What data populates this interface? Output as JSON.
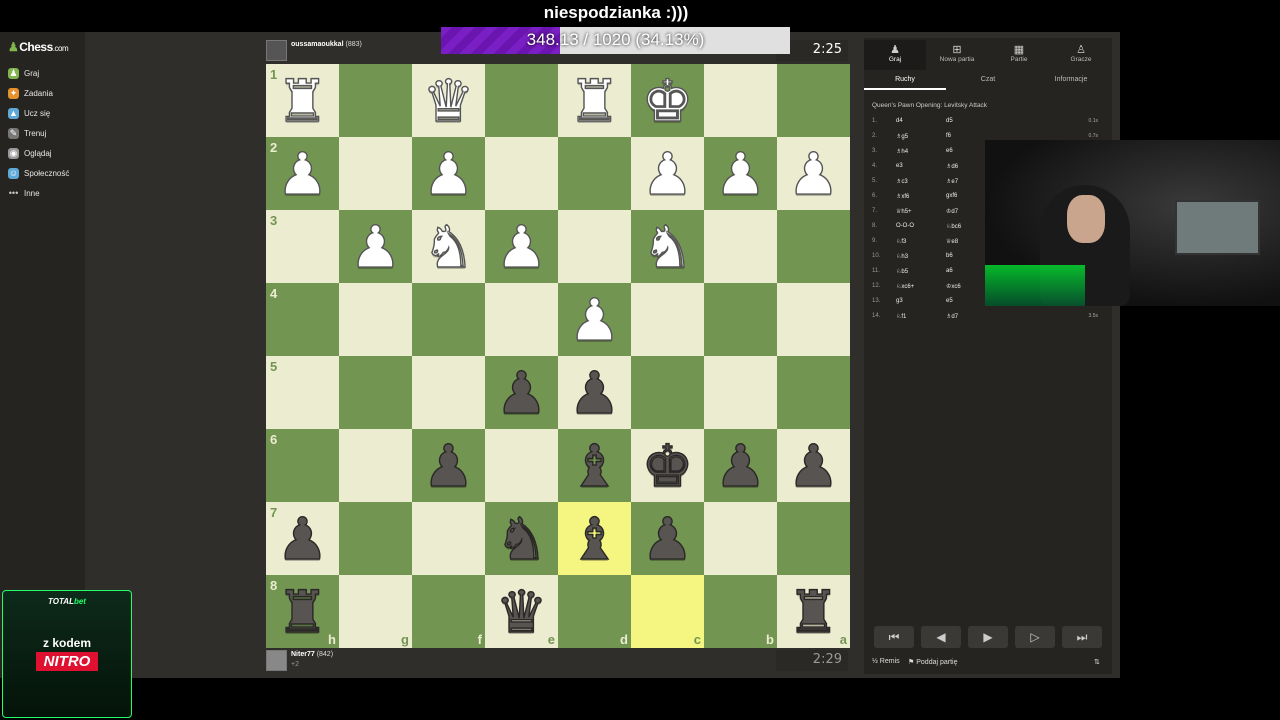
{
  "overlay": {
    "title": "niespodzianka :)))",
    "progress_text": "348.13 / 1020 (34.13%)",
    "progress_fraction": 0.3413
  },
  "sidebar": {
    "logo": "Chess",
    "logo_suffix": ".com",
    "items": [
      {
        "label": "Graj",
        "icon": "play-icon",
        "color": "#81b64c"
      },
      {
        "label": "Zadania",
        "icon": "puzzle-icon",
        "color": "#e6912c"
      },
      {
        "label": "Ucz się",
        "icon": "learn-icon",
        "color": "#5fa9d8"
      },
      {
        "label": "Trenuj",
        "icon": "train-icon",
        "color": "#777777"
      },
      {
        "label": "Oglądaj",
        "icon": "watch-icon",
        "color": "#999999"
      },
      {
        "label": "Społeczność",
        "icon": "community-icon",
        "color": "#5fa9d8"
      },
      {
        "label": "Inne",
        "icon": "more-icon",
        "color": "#999999"
      }
    ]
  },
  "top_player": {
    "name": "oussamaoukkal",
    "rating": "(883)",
    "clock": "2:25"
  },
  "bottom_player": {
    "name": "Niter77",
    "rating": "(842)",
    "sub": "+2",
    "clock": "2:29"
  },
  "board": {
    "ranks": [
      "1",
      "2",
      "3",
      "4",
      "5",
      "6",
      "7",
      "8"
    ],
    "files": [
      "h",
      "g",
      "f",
      "e",
      "d",
      "c",
      "b",
      "a"
    ],
    "rows": [
      [
        "wR",
        "",
        "wQ",
        "",
        "wR",
        "wK",
        "",
        ""
      ],
      [
        "wP",
        "",
        "wP",
        "",
        "",
        "wP",
        "wP",
        "wP"
      ],
      [
        "",
        "wP",
        "wN",
        "wP",
        "",
        "wN",
        "",
        ""
      ],
      [
        "",
        "",
        "",
        "",
        "wP",
        "",
        "",
        ""
      ],
      [
        "",
        "",
        "",
        "bP",
        "bP",
        "",
        "",
        ""
      ],
      [
        "",
        "",
        "bP",
        "",
        "bB",
        "bK",
        "bP",
        "bP"
      ],
      [
        "bP",
        "",
        "",
        "bN",
        "bB",
        "bP",
        "",
        ""
      ],
      [
        "bR",
        "",
        "",
        "bQ",
        "",
        "",
        "",
        "bR"
      ]
    ],
    "highlight": [
      "6-4",
      "7-5"
    ]
  },
  "right_panel": {
    "tabs": [
      {
        "label": "Graj",
        "icon": "play-icon"
      },
      {
        "label": "Nowa partia",
        "icon": "plus-icon"
      },
      {
        "label": "Partie",
        "icon": "board-icon"
      },
      {
        "label": "Gracze",
        "icon": "players-icon"
      }
    ],
    "subtabs": [
      "Ruchy",
      "Czat",
      "Informacje"
    ],
    "opening": "Queen's Pawn Opening: Levitsky Attack",
    "moves": [
      {
        "n": "1.",
        "w": "d4",
        "b": "d5",
        "t": "0.1s"
      },
      {
        "n": "2.",
        "w": "♗g5",
        "b": "f6",
        "t": "0.7s"
      },
      {
        "n": "3.",
        "w": "♗h4",
        "b": "e6",
        "t": ""
      },
      {
        "n": "4.",
        "w": "e3",
        "b": "♗d6",
        "t": ""
      },
      {
        "n": "5.",
        "w": "♗c3",
        "b": "♗e7",
        "t": ""
      },
      {
        "n": "6.",
        "w": "♗xf6",
        "b": "gxf6",
        "t": ""
      },
      {
        "n": "7.",
        "w": "♕h5+",
        "b": "♔d7",
        "t": ""
      },
      {
        "n": "8.",
        "w": "O-O-O",
        "b": "♘bc6",
        "t": ""
      },
      {
        "n": "9.",
        "w": "♘f3",
        "b": "♕e8",
        "t": ""
      },
      {
        "n": "10.",
        "w": "♘h3",
        "b": "b6",
        "t": ""
      },
      {
        "n": "11.",
        "w": "♘b5",
        "b": "a6",
        "t": ""
      },
      {
        "n": "12.",
        "w": "♘xc6+",
        "b": "♔xc6",
        "t": ""
      },
      {
        "n": "13.",
        "w": "g3",
        "b": "e5",
        "t": ""
      },
      {
        "n": "14.",
        "w": "♘f1",
        "b": "♗d7",
        "t": "3.5s"
      }
    ],
    "controls": [
      "⏮",
      "◀",
      "▶",
      "▷",
      "⏭"
    ],
    "draw_label": "Remis",
    "resign_label": "Poddaj partię"
  },
  "promo": {
    "brand_a": "TOTAL",
    "brand_b": "bet",
    "code_label": "z kodem",
    "code": "NITRO"
  }
}
